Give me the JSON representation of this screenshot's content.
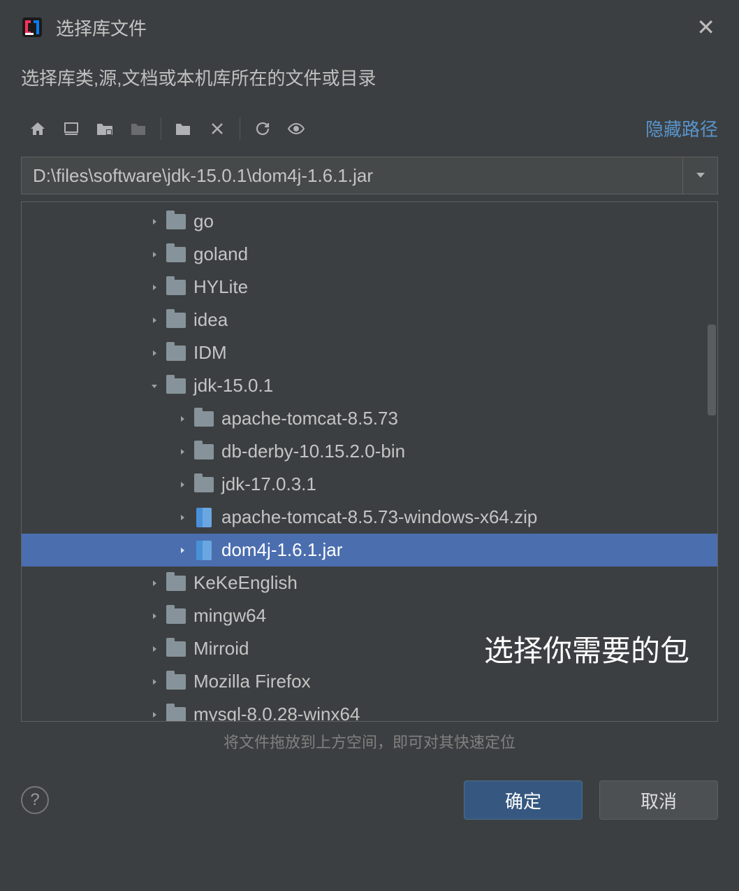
{
  "dialog": {
    "title": "选择库文件",
    "subtitle": "选择库类,源,文档或本机库所在的文件或目录"
  },
  "toolbar": {
    "hide_path_label": "隐藏路径"
  },
  "path": {
    "value": "D:\\files\\software\\jdk-15.0.1\\dom4j-1.6.1.jar"
  },
  "tree": {
    "items": [
      {
        "name": "go",
        "type": "folder",
        "indent": 0,
        "expanded": false,
        "selected": false
      },
      {
        "name": "goland",
        "type": "folder",
        "indent": 0,
        "expanded": false,
        "selected": false
      },
      {
        "name": "HYLite",
        "type": "folder",
        "indent": 0,
        "expanded": false,
        "selected": false
      },
      {
        "name": "idea",
        "type": "folder",
        "indent": 0,
        "expanded": false,
        "selected": false
      },
      {
        "name": "IDM",
        "type": "folder",
        "indent": 0,
        "expanded": false,
        "selected": false
      },
      {
        "name": "jdk-15.0.1",
        "type": "folder",
        "indent": 0,
        "expanded": true,
        "selected": false
      },
      {
        "name": "apache-tomcat-8.5.73",
        "type": "folder",
        "indent": 1,
        "expanded": false,
        "selected": false
      },
      {
        "name": "db-derby-10.15.2.0-bin",
        "type": "folder",
        "indent": 1,
        "expanded": false,
        "selected": false
      },
      {
        "name": "jdk-17.0.3.1",
        "type": "folder",
        "indent": 1,
        "expanded": false,
        "selected": false
      },
      {
        "name": "apache-tomcat-8.5.73-windows-x64.zip",
        "type": "archive",
        "indent": 1,
        "expanded": false,
        "selected": false
      },
      {
        "name": "dom4j-1.6.1.jar",
        "type": "archive",
        "indent": 1,
        "expanded": false,
        "selected": true
      },
      {
        "name": "KeKeEnglish",
        "type": "folder",
        "indent": 0,
        "expanded": false,
        "selected": false
      },
      {
        "name": "mingw64",
        "type": "folder",
        "indent": 0,
        "expanded": false,
        "selected": false
      },
      {
        "name": "Mirroid",
        "type": "folder",
        "indent": 0,
        "expanded": false,
        "selected": false
      },
      {
        "name": "Mozilla Firefox",
        "type": "folder",
        "indent": 0,
        "expanded": false,
        "selected": false
      },
      {
        "name": "mysql-8.0.28-winx64",
        "type": "folder",
        "indent": 0,
        "expanded": false,
        "selected": false
      }
    ]
  },
  "annotation": "选择你需要的包",
  "drop_hint": "将文件拖放到上方空间，即可对其快速定位",
  "footer": {
    "ok_label": "确定",
    "cancel_label": "取消"
  }
}
